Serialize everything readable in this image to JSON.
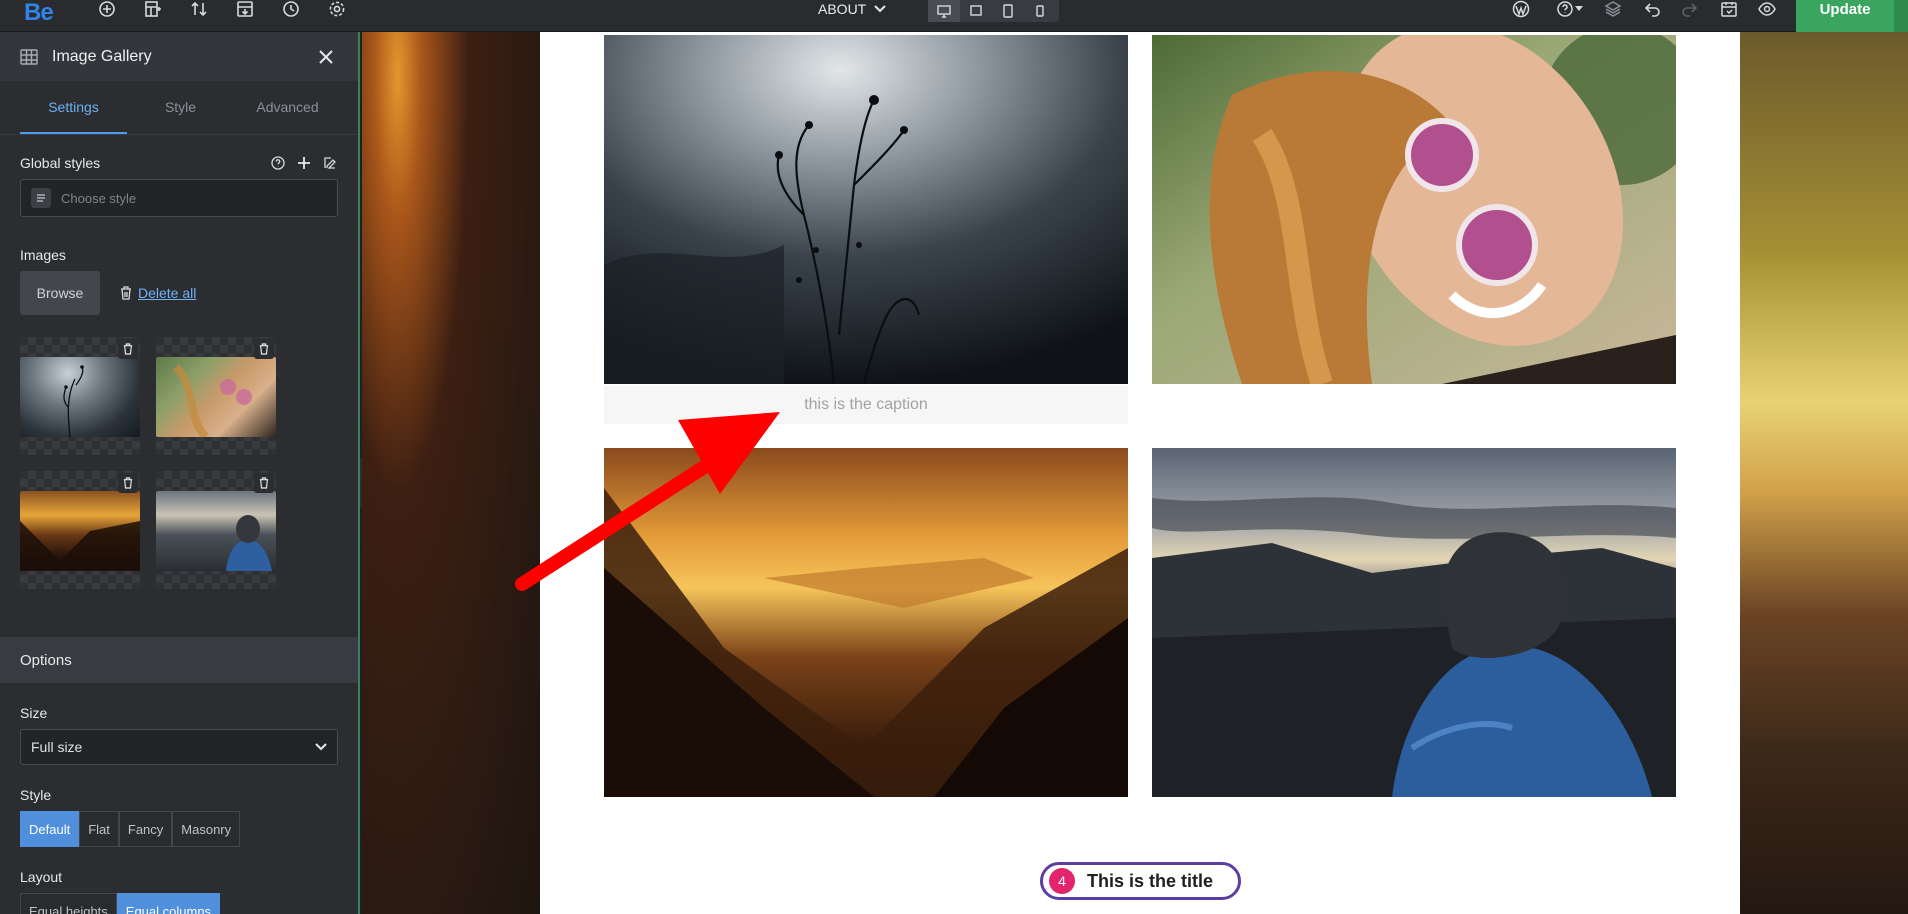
{
  "topbar": {
    "logo": "Be",
    "page_selector": "ABOUT",
    "update_label": "Update",
    "icons": [
      "plus-circle-icon",
      "add-section-icon",
      "sort-icon",
      "import-icon",
      "history-icon",
      "settings-icon",
      "wordpress-icon",
      "help-icon",
      "layers-icon",
      "undo-icon",
      "redo-icon",
      "calendar-icon",
      "preview-icon"
    ],
    "devices": [
      "desktop",
      "laptop",
      "tablet",
      "mobile"
    ],
    "active_device": "desktop"
  },
  "sidebar": {
    "title": "Image Gallery",
    "tabs": [
      {
        "label": "Settings",
        "active": true
      },
      {
        "label": "Style",
        "active": false
      },
      {
        "label": "Advanced",
        "active": false
      }
    ],
    "global_styles": {
      "label": "Global styles",
      "placeholder": "Choose style"
    },
    "images": {
      "label": "Images",
      "browse_label": "Browse",
      "delete_all_label": "Delete all"
    },
    "options_label": "Options",
    "size": {
      "label": "Size",
      "value": "Full size"
    },
    "style": {
      "label": "Style",
      "options": [
        "Default",
        "Flat",
        "Fancy",
        "Masonry"
      ],
      "selected": "Default"
    },
    "layout": {
      "label": "Layout",
      "options": [
        "Equal heights",
        "Equal columns"
      ],
      "selected": "Equal columns"
    }
  },
  "canvas": {
    "caption": "this is the caption",
    "title_number": "4",
    "title_text": "This is the title"
  },
  "colors": {
    "accent": "#4d9bef",
    "update": "#3aa55e",
    "arrow": "#ff0000",
    "title_border": "#5a3ea1",
    "title_badge": "#e3246c"
  }
}
